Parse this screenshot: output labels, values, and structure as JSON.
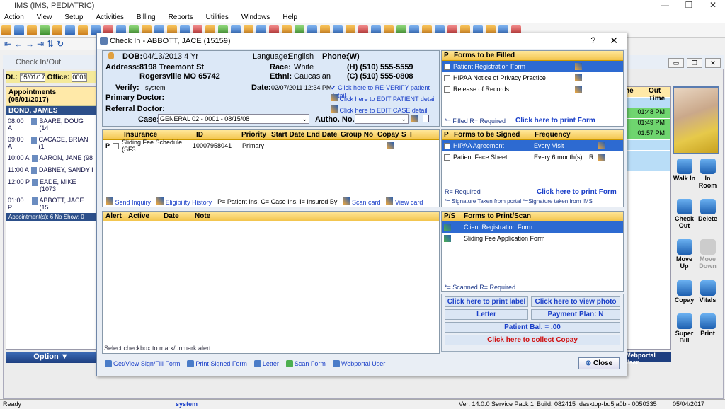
{
  "app": {
    "title": "IMS (IMS, PEDIATRIC)"
  },
  "menu": [
    "Action",
    "View",
    "Setup",
    "Activities",
    "Billing",
    "Reports",
    "Utilities",
    "Windows",
    "Help"
  ],
  "bg": {
    "window_title": "Check In/Out",
    "dt_label": "Dt.:",
    "dt_value": "05/01/17",
    "office_label": "Office:",
    "office_value": "0001",
    "appt_header": "Appointments (05/01/2017)",
    "doctor": "BOND, JAMES",
    "appointments": [
      {
        "time": "08:00 A",
        "name": "BAARE, DOUG (14"
      },
      {
        "time": "09:00 A",
        "name": "CACACE, BRIAN (1"
      },
      {
        "time": "10:00 A",
        "name": "AARON, JANE (98"
      },
      {
        "time": "11:00 A",
        "name": "DABNEY, SANDY I"
      },
      {
        "time": "12:00 P",
        "name": "EADE, MIKE (1073"
      },
      {
        "time": "01:00 P",
        "name": "ABBOTT, JACE (15"
      }
    ],
    "appt_footer": "Appointment(s): 6   No Show: 0",
    "option_label": "Option ▼",
    "right_cols": [
      "ne",
      "Out Time"
    ],
    "out_times": [
      "01:48 PM",
      "01:49 PM",
      "01:57 PM"
    ],
    "webportal_user": "Webportal User",
    "actions": [
      {
        "label": "Walk In",
        "icon": "walk-in-icon"
      },
      {
        "label": "In Room",
        "icon": "in-room-icon"
      },
      {
        "label": "Check Out",
        "icon": "check-out-icon"
      },
      {
        "label": "Delete",
        "icon": "delete-icon"
      },
      {
        "label": "Move Up",
        "icon": "move-up-icon"
      },
      {
        "label": "Move Down",
        "icon": "move-down-icon"
      },
      {
        "label": "Copay",
        "icon": "copay-icon"
      },
      {
        "label": "Vitals",
        "icon": "vitals-icon"
      },
      {
        "label": "Super Bill",
        "icon": "super-bill-icon"
      },
      {
        "label": "Print",
        "icon": "print-icon"
      }
    ]
  },
  "dialog": {
    "title": "Check In - ABBOTT, JACE  (15159)",
    "help": "?",
    "close": "✕",
    "patient": {
      "dob_label": "DOB:",
      "dob": "04/13/2013  4 Yr",
      "language_label": "Language:",
      "language": "English",
      "phone_label": "Phone:",
      "phone_type": "(W)",
      "address_label": "Address:",
      "address1": "8198 Treemont St",
      "address2": "Rogersville  MO  65742",
      "race_label": "Race:",
      "race": "White",
      "ethni_label": "Ethni:",
      "ethni": "Caucasian",
      "home_phone": "(H)   (510) 555-5559",
      "cell_phone": "(C)   (510) 555-0808",
      "verify_label": "Verify:",
      "verify": "system",
      "date_label": "Date:",
      "date": "02/07/2011 12:34 PM",
      "reverify_link": "Click here to RE-VERIFY patient detail",
      "primary_doctor_label": "Primary Doctor:",
      "edit_patient_link": "Click here to EDIT PATIENT detail",
      "referral_label": "Referral Doctor:",
      "edit_case_link": "Click here to EDIT CASE detail",
      "case_label": "Case:",
      "case_value": "GENERAL 02  -  0001 - 08/15/08",
      "autho_label": "Autho. No.:"
    },
    "insurance": {
      "headers": [
        "Insurance",
        "ID",
        "Priority",
        "Start Date",
        "End Date",
        "Group No",
        "Copay",
        "S",
        "I"
      ],
      "rows": [
        {
          "p": "P",
          "name": "Sliding Fee Schedule  (SF3",
          "id": "10007958041",
          "priority": "Primary"
        }
      ],
      "footer": {
        "send_inquiry": "Send Inquiry",
        "eligibility": "Eligibility History",
        "legend": "P= Patient Ins.  C= Case Ins.  I= Insured By",
        "scan": "Scan card",
        "view": "View card"
      }
    },
    "alerts": {
      "headers": [
        "Alert",
        "Active",
        "Date",
        "Note"
      ],
      "footer": "Select checkbox to mark/unmark alert"
    },
    "forms_filled": {
      "headers": [
        "P",
        "Forms to be Filled"
      ],
      "rows": [
        "Patient Registration Form",
        "HIPAA Notice of Privacy Practice",
        "Release of Records"
      ],
      "legend": "*= Filled  R= Required",
      "print": "Click here to print Form"
    },
    "forms_signed": {
      "headers": [
        "P",
        "Forms to be Signed",
        "Frequency"
      ],
      "rows": [
        {
          "name": "HIPAA Agreement",
          "freq": "Every Visit",
          "r": ""
        },
        {
          "name": "Patient Face Sheet",
          "freq": "Every 6 month(s)",
          "r": "R"
        }
      ],
      "legend1": "R= Required",
      "print": "Click here to print Form",
      "legend2": "*= Signature Taken from portal  *=Signature taken from IMS"
    },
    "forms_print": {
      "headers": [
        "P/S",
        "Forms to Print/Scan"
      ],
      "rows": [
        "Client Registration Form",
        "Sliding Fee Application Form"
      ],
      "legend": "*= Scanned   R= Required"
    },
    "buttons": {
      "print_label": "Click here to print label",
      "view_photo": "Click here to view photo",
      "letter": "Letter",
      "payment_plan": "Payment Plan: N",
      "patient_bal": "Patient Bal. = .00",
      "collect_copay": "Click here to collect Copay"
    },
    "bottom": [
      "Get/View Sign/Fill Form",
      "Print Signed Form",
      "Letter",
      "Scan Form",
      "Webportal User"
    ],
    "close_btn": "Close"
  },
  "status": {
    "ready": "Ready",
    "user": "system",
    "version": "Ver: 14.0.0 Service Pack 1",
    "build": "Build: 082415",
    "machine": "desktop-bq5ja0b - 0050335",
    "date": "05/04/2017"
  },
  "colors": {
    "accent": "#2d6ad1",
    "header_gold": "#f3c54d",
    "link": "#1a3fc8",
    "copay_red": "#d01010"
  }
}
